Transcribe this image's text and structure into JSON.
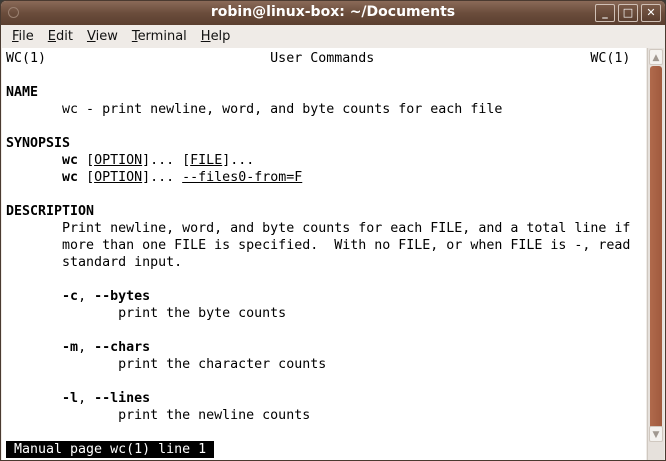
{
  "window": {
    "title": "robin@linux-box: ~/Documents"
  },
  "menu": [
    {
      "key": "F",
      "rest": "ile"
    },
    {
      "key": "E",
      "rest": "dit"
    },
    {
      "key": "V",
      "rest": "iew"
    },
    {
      "key": "T",
      "rest": "erminal"
    },
    {
      "key": "H",
      "rest": "elp"
    }
  ],
  "lines": [
    [
      {
        "t": "WC(1)                            User Commands                           WC(1)"
      }
    ],
    [],
    [
      {
        "t": "NAME",
        "s": "b"
      }
    ],
    [
      {
        "t": "       wc - print newline, word, and byte counts for each file"
      }
    ],
    [],
    [
      {
        "t": "SYNOPSIS",
        "s": "b"
      }
    ],
    [
      {
        "t": "       "
      },
      {
        "t": "wc",
        "s": "b"
      },
      {
        "t": " ["
      },
      {
        "t": "OPTION",
        "s": "u"
      },
      {
        "t": "]... ["
      },
      {
        "t": "FILE",
        "s": "u"
      },
      {
        "t": "]..."
      }
    ],
    [
      {
        "t": "       "
      },
      {
        "t": "wc",
        "s": "b"
      },
      {
        "t": " ["
      },
      {
        "t": "OPTION",
        "s": "u"
      },
      {
        "t": "]... "
      },
      {
        "t": "--files0-from=F",
        "s": "u"
      }
    ],
    [],
    [
      {
        "t": "DESCRIPTION",
        "s": "b"
      }
    ],
    [
      {
        "t": "       Print newline, word, and byte counts for each FILE, and a total line if"
      }
    ],
    [
      {
        "t": "       more than one FILE is specified.  With no FILE, or when FILE is -, read"
      }
    ],
    [
      {
        "t": "       standard input."
      }
    ],
    [],
    [
      {
        "t": "       "
      },
      {
        "t": "-c",
        "s": "b"
      },
      {
        "t": ", "
      },
      {
        "t": "--bytes",
        "s": "b"
      }
    ],
    [
      {
        "t": "              print the byte counts"
      }
    ],
    [],
    [
      {
        "t": "       "
      },
      {
        "t": "-m",
        "s": "b"
      },
      {
        "t": ", "
      },
      {
        "t": "--chars",
        "s": "b"
      }
    ],
    [
      {
        "t": "              print the character counts"
      }
    ],
    [],
    [
      {
        "t": "       "
      },
      {
        "t": "-l",
        "s": "b"
      },
      {
        "t": ", "
      },
      {
        "t": "--lines",
        "s": "b"
      }
    ],
    [
      {
        "t": "              print the newline counts"
      }
    ],
    [],
    [
      {
        "t": " Manual page wc(1) line 1",
        "s": "status"
      }
    ]
  ]
}
